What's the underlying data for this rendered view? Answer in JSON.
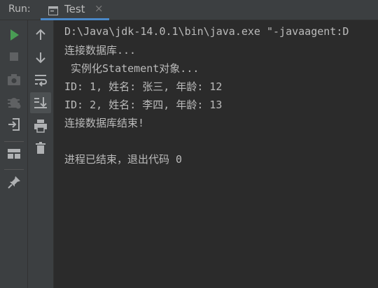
{
  "header": {
    "run_label": "Run:",
    "tab_title": "Test",
    "tab_close": "×"
  },
  "left_toolbar": {
    "icons": [
      "rerun-icon",
      "stop-icon",
      "camera-icon",
      "debug-icon",
      "exit-icon",
      "layout-icon",
      "pin-icon"
    ]
  },
  "mid_toolbar": {
    "icons": [
      "arrow-up-icon",
      "arrow-down-icon",
      "soft-wrap-icon",
      "scroll-to-end-icon",
      "print-icon",
      "trash-icon"
    ]
  },
  "console": {
    "lines": [
      "D:\\Java\\jdk-14.0.1\\bin\\java.exe \"-javaagent:D",
      "连接数据库...",
      " 实例化Statement对象...",
      "ID: 1, 姓名: 张三, 年龄: 12",
      "ID: 2, 姓名: 李四, 年龄: 13",
      "连接数据库结束!",
      "",
      "进程已结束，退出代码 0"
    ]
  },
  "colors": {
    "run_green": "#499c54",
    "tab_accent": "#4a88c7",
    "console_text": "#bbbbbb",
    "icon_gray": "#afb1b3",
    "icon_disabled": "#5f6163"
  }
}
